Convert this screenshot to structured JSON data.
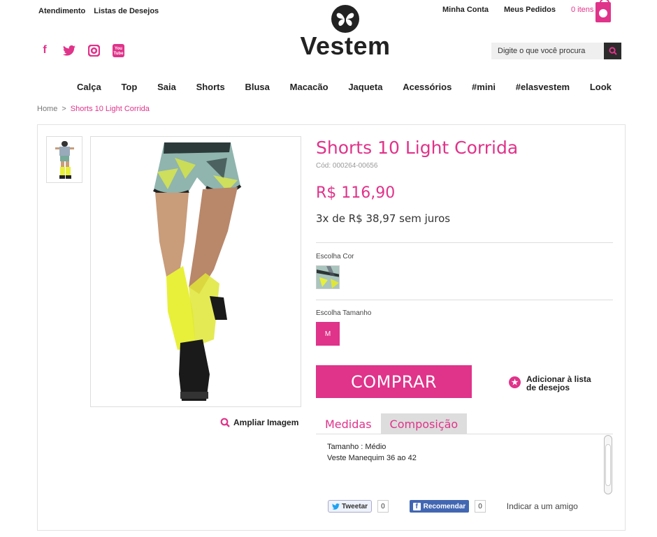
{
  "header": {
    "top_links": [
      "Atendimento",
      "Listas de Desejos"
    ],
    "account_links": [
      "Minha Conta",
      "Meus Pedidos"
    ],
    "cart_text": "0 itens",
    "logo_text": "Vestem",
    "social_icons": [
      "facebook-icon",
      "twitter-icon",
      "instagram-icon",
      "youtube-icon"
    ],
    "youtube_text": "You Tube",
    "search_placeholder": "Digite o que você procura"
  },
  "nav": [
    "Calça",
    "Top",
    "Saia",
    "Shorts",
    "Blusa",
    "Macacão",
    "Jaqueta",
    "Acessórios",
    "#mini",
    "#elasvestem",
    "Look"
  ],
  "breadcrumb": {
    "home": "Home",
    "separator": ">",
    "current": "Shorts 10 Light Corrida"
  },
  "product": {
    "name": "Shorts 10 Light Corrida",
    "code": "Cód: 000264-00656",
    "price": "R$ 116,90",
    "installments": "3x de R$ 38,97 sem juros",
    "color_label": "Escolha Cor",
    "size_label": "Escolha Tamanho",
    "size_option": "M",
    "buy_label": "COMPRAR",
    "wishlist_label_1": "Adicionar à lista",
    "wishlist_label_2": "de desejos",
    "zoom_label": "Ampliar Imagem"
  },
  "tabs": [
    {
      "label": "Medidas",
      "active": true
    },
    {
      "label": "Composição",
      "active": false
    }
  ],
  "tab_content": [
    "Tamanho : Médio",
    "Veste Manequim 36 ao 42"
  ],
  "share": {
    "tweet_label": "Tweetar",
    "tweet_count": "0",
    "fb_label": "Recomendar",
    "fb_count": "0",
    "friend_label": "Indicar a um amigo"
  },
  "colors": {
    "accent": "#e0338a",
    "dark": "#2b2b2b",
    "neon": "#e8f03a"
  }
}
